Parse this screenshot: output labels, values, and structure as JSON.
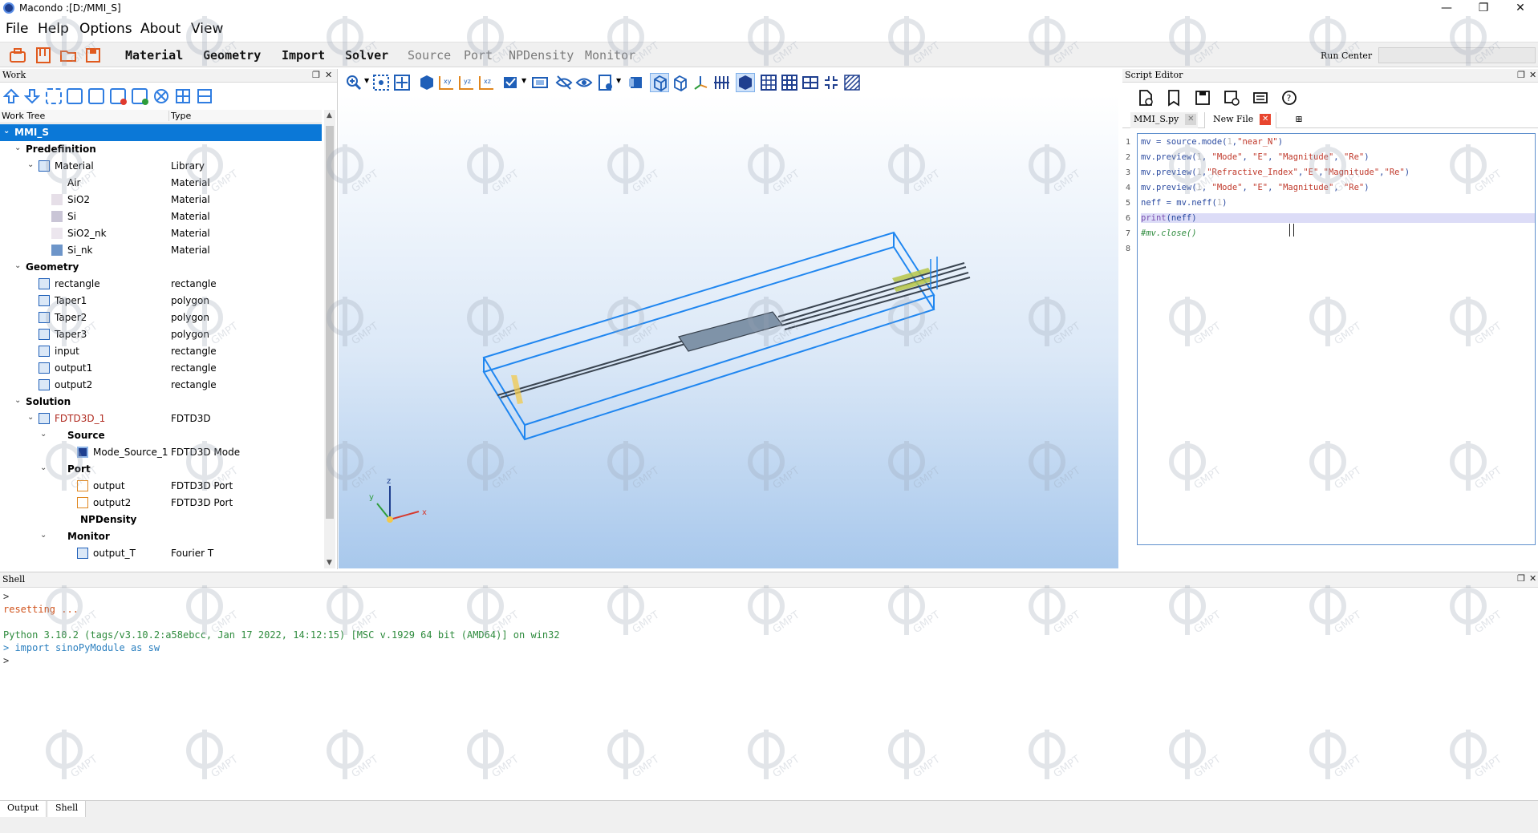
{
  "window": {
    "title": "Macondo :[D:/MMI_S]",
    "minimize": "—",
    "restore": "❐",
    "close": "✕"
  },
  "menu": [
    "File",
    "Help",
    "Options",
    "About",
    "View"
  ],
  "toolbar": {
    "labels": [
      {
        "text": "Material",
        "style": "bold"
      },
      {
        "text": "Geometry",
        "style": "bold"
      },
      {
        "text": "Import",
        "style": "bold"
      },
      {
        "text": "Solver",
        "style": "bold"
      },
      {
        "text": "Source",
        "style": "dim"
      },
      {
        "text": "Port",
        "style": "dim"
      },
      {
        "text": "NPDensity",
        "style": "dim"
      },
      {
        "text": "Monitor",
        "style": "dim"
      }
    ],
    "run_center": "Run Center"
  },
  "work_panel": {
    "title": "Work",
    "col_tree": "Work Tree",
    "col_type": "Type",
    "rows": [
      {
        "label": "MMI_S",
        "type": "",
        "indent": 0,
        "chev": "v",
        "selected": true
      },
      {
        "label": "Predefinition",
        "type": "",
        "indent": 1,
        "chev": "v",
        "bold": true
      },
      {
        "label": "Material",
        "type": "Library",
        "indent": 2,
        "chev": "v",
        "icon": "material-library-icon"
      },
      {
        "label": "Air",
        "type": "Material",
        "indent": 3
      },
      {
        "label": "SiO2",
        "type": "Material",
        "indent": 3,
        "swatch": "#e6dfe8"
      },
      {
        "label": "Si",
        "type": "Material",
        "indent": 3,
        "swatch": "#c9c5d6"
      },
      {
        "label": "SiO2_nk",
        "type": "Material",
        "indent": 3,
        "swatch": "#ece6ee"
      },
      {
        "label": "Si_nk",
        "type": "Material",
        "indent": 3,
        "swatch": "#6d95c9"
      },
      {
        "label": "Geometry",
        "type": "",
        "indent": 1,
        "chev": "v",
        "bold": true
      },
      {
        "label": "rectangle",
        "type": "rectangle",
        "indent": 2,
        "icon": "geometry-icon"
      },
      {
        "label": "Taper1",
        "type": "polygon",
        "indent": 2,
        "icon": "geometry-icon"
      },
      {
        "label": "Taper2",
        "type": "polygon",
        "indent": 2,
        "icon": "geometry-icon"
      },
      {
        "label": "Taper3",
        "type": "polygon",
        "indent": 2,
        "icon": "geometry-icon"
      },
      {
        "label": "input",
        "type": "rectangle",
        "indent": 2,
        "icon": "geometry-icon"
      },
      {
        "label": "output1",
        "type": "rectangle",
        "indent": 2,
        "icon": "geometry-icon"
      },
      {
        "label": "output2",
        "type": "rectangle",
        "indent": 2,
        "icon": "geometry-icon"
      },
      {
        "label": "Solution",
        "type": "",
        "indent": 1,
        "chev": "v",
        "bold": true
      },
      {
        "label": "FDTD3D_1",
        "type": "FDTD3D",
        "indent": 2,
        "chev": "v",
        "icon": "solver-icon",
        "red": true
      },
      {
        "label": "Source",
        "type": "",
        "indent": 3,
        "chev": "v",
        "bold": true
      },
      {
        "label": "Mode_Source_1",
        "type": "FDTD3D Mode",
        "indent": 5,
        "icon": "source-icon"
      },
      {
        "label": "Port",
        "type": "",
        "indent": 3,
        "chev": "v",
        "bold": true
      },
      {
        "label": "output",
        "type": "FDTD3D Port",
        "indent": 5,
        "icon": "port-icon"
      },
      {
        "label": "output2",
        "type": "FDTD3D Port",
        "indent": 5,
        "icon": "port-icon"
      },
      {
        "label": "NPDensity",
        "type": "",
        "indent": 4,
        "bold": true
      },
      {
        "label": "Monitor",
        "type": "",
        "indent": 3,
        "chev": "v",
        "bold": true
      },
      {
        "label": "output_T",
        "type": "Fourier T",
        "indent": 5,
        "icon": "monitor-icon"
      }
    ]
  },
  "script_editor": {
    "title": "Script Editor",
    "tabs": [
      {
        "label": "MMI_S.py",
        "active": false
      },
      {
        "label": "New File",
        "active": true
      }
    ],
    "lines": [
      "1",
      "2",
      "3",
      "4",
      "5",
      "6",
      "7",
      "8"
    ],
    "code": [
      {
        "parts": [
          [
            "",
            "mv = source.mode("
          ],
          [
            "num",
            "1"
          ],
          [
            "",
            ","
          ],
          [
            "str",
            "\"near_N\""
          ],
          [
            "",
            ")"
          ]
        ]
      },
      {
        "parts": [
          [
            "",
            "mv.preview("
          ],
          [
            "num",
            "1"
          ],
          [
            "",
            ", "
          ],
          [
            "str",
            "\"Mode\""
          ],
          [
            "",
            ", "
          ],
          [
            "str",
            "\"E\""
          ],
          [
            "",
            ", "
          ],
          [
            "str",
            "\"Magnitude\""
          ],
          [
            "",
            ", "
          ],
          [
            "str",
            "\"Re\""
          ],
          [
            "",
            ")"
          ]
        ]
      },
      {
        "parts": [
          [
            "",
            "mv.preview("
          ],
          [
            "num",
            "1"
          ],
          [
            "",
            ","
          ],
          [
            "str",
            "\"Refractive_Index\""
          ],
          [
            "",
            ","
          ],
          [
            "str",
            "\"E\""
          ],
          [
            "",
            ","
          ],
          [
            "str",
            "\"Magnitude\""
          ],
          [
            "",
            ","
          ],
          [
            "str",
            "\"Re\""
          ],
          [
            "",
            ")"
          ]
        ]
      },
      {
        "parts": [
          [
            "",
            "mv.preview("
          ],
          [
            "num",
            "1"
          ],
          [
            "",
            ", "
          ],
          [
            "str",
            "\"Mode\""
          ],
          [
            "",
            ", "
          ],
          [
            "str",
            "\"E\""
          ],
          [
            "",
            ", "
          ],
          [
            "str",
            "\"Magnitude\""
          ],
          [
            "",
            ", "
          ],
          [
            "str",
            "\"Re\""
          ],
          [
            "",
            ")"
          ]
        ]
      },
      {
        "parts": [
          [
            "",
            "neff = mv.neff("
          ],
          [
            "num",
            "1"
          ],
          [
            "",
            ")"
          ]
        ]
      },
      {
        "parts": [
          [
            "kw",
            "print"
          ],
          [
            "",
            "(neff)"
          ]
        ],
        "highlight": true
      },
      {
        "parts": [
          [
            "cmt",
            "#mv.close()"
          ]
        ]
      },
      {
        "parts": []
      }
    ]
  },
  "shell": {
    "title": "Shell",
    "lines": [
      {
        "text": ">",
        "color": "#333333"
      },
      {
        "text": "resetting ...",
        "color": "#d0531c"
      },
      {
        "text": "",
        "color": "#333333"
      },
      {
        "text": "Python 3.10.2 (tags/v3.10.2:a58ebcc, Jan 17 2022, 14:12:15) [MSC v.1929 64 bit (AMD64)] on win32",
        "color": "#2e8b3d"
      },
      {
        "text": "> import sinoPyModule as sw",
        "color": "#2a7fbf"
      },
      {
        "text": ">",
        "color": "#333333"
      }
    ]
  },
  "bottom_tabs": [
    "Output",
    "Shell"
  ],
  "axes": {
    "x": "x",
    "y": "y",
    "z": "z"
  },
  "watermark": "GMPT",
  "colors": {
    "accent": "#0b78d7",
    "wire": "#1f86f0"
  }
}
